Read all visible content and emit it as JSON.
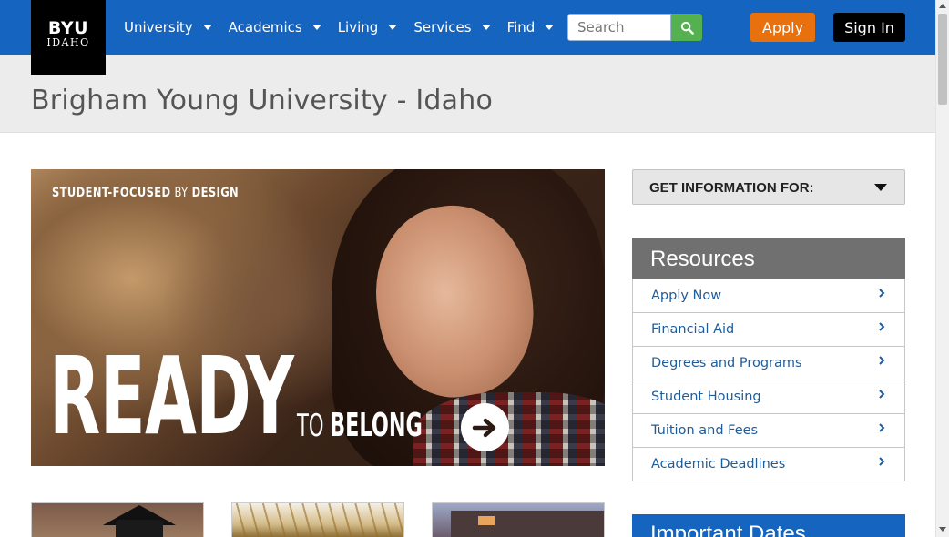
{
  "brand": {
    "line1": "BYU",
    "line2": "IDAHO"
  },
  "nav": {
    "items": [
      {
        "label": "University"
      },
      {
        "label": "Academics"
      },
      {
        "label": "Living"
      },
      {
        "label": "Services"
      },
      {
        "label": "Find"
      }
    ]
  },
  "search": {
    "placeholder": "Search",
    "icon": "search-icon"
  },
  "header_buttons": {
    "apply": "Apply",
    "sign_in": "Sign In"
  },
  "page_title": "Brigham Young University - Idaho",
  "hero": {
    "tagline_strong1": "STUDENT-FOCUSED",
    "tagline_by": " BY ",
    "tagline_strong2": "DESIGN",
    "headline": "READY",
    "sub_to": "TO ",
    "sub_belong": "BELONG",
    "arrow_icon": "arrow-right-icon"
  },
  "get_info": {
    "label": "GET INFORMATION FOR:"
  },
  "resources": {
    "title": "Resources",
    "items": [
      {
        "label": "Apply Now"
      },
      {
        "label": "Financial Aid"
      },
      {
        "label": "Degrees and Programs"
      },
      {
        "label": "Student Housing"
      },
      {
        "label": "Tuition and Fees"
      },
      {
        "label": "Academic Deadlines"
      }
    ]
  },
  "important_dates": {
    "title": "Important Dates"
  },
  "colors": {
    "nav_blue": "#1565c0",
    "apply_orange": "#e8700d",
    "search_green": "#55b04f",
    "link_blue": "#1f5c9a",
    "resources_header_gray": "#707070"
  }
}
